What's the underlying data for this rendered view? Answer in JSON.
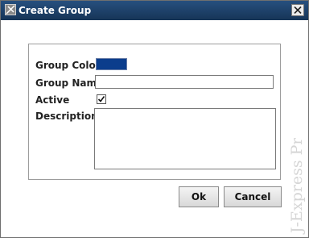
{
  "window": {
    "title": "Create Group"
  },
  "form": {
    "group_color_label": "Group Color",
    "group_color_value": "#0b3d8c",
    "group_name_label": "Group Name",
    "group_name_value": "",
    "active_label": "Active",
    "active_checked": true,
    "description_label": "Description",
    "description_value": ""
  },
  "buttons": {
    "ok_label": "Ok",
    "cancel_label": "Cancel"
  },
  "watermark": {
    "text": "J-Express Pro"
  },
  "colors": {
    "titlebar": "#1f446d",
    "accent": "#0b3d8c"
  }
}
